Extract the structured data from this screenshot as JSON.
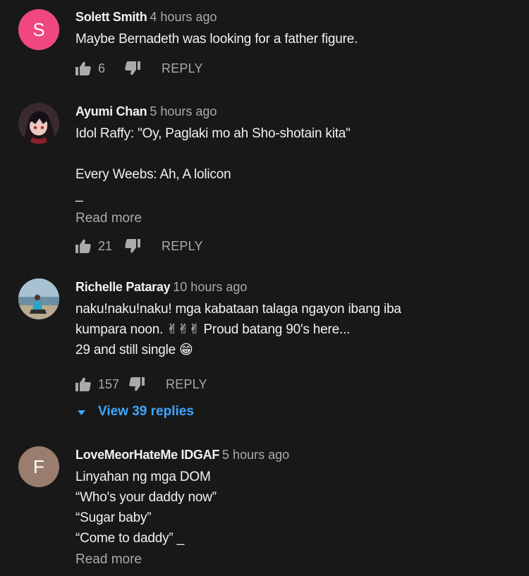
{
  "comments": [
    {
      "author": "Solett Smith",
      "time": "4 hours ago",
      "avatar": {
        "type": "letter",
        "letter": "S",
        "color": "#f0487e"
      },
      "lines": [
        "Maybe Bernadeth was looking for a father figure."
      ],
      "likes": "6",
      "reply_label": "REPLY"
    },
    {
      "author": "Ayumi Chan",
      "time": "5 hours ago",
      "avatar": {
        "type": "image",
        "description": "anime-character-icon"
      },
      "lines": [
        "Idol Raffy: \"Oy, Paglaki mo ah Sho-shotain kita\"",
        "",
        "Every Weebs: Ah, A lolicon",
        "_"
      ],
      "read_more": "Read more",
      "likes": "21",
      "reply_label": "REPLY"
    },
    {
      "author": "Richelle Pataray",
      "time": "10 hours ago",
      "avatar": {
        "type": "image",
        "description": "beach-photo-icon"
      },
      "lines": [
        "naku!naku!naku! mga kabataan talaga ngayon ibang iba",
        "kumpara noon. ✌✌✌ Proud batang 90's here...",
        "29 and still single 😁"
      ],
      "likes": "157",
      "reply_label": "REPLY",
      "replies_label": "View 39 replies"
    },
    {
      "author": "LoveMeorHateMe IDGAF",
      "time": "5 hours ago",
      "avatar": {
        "type": "letter",
        "letter": "F",
        "color": "#9a7d6e"
      },
      "lines": [
        "Linyahan ng mga DOM",
        "“Who's your daddy now”",
        "“Sugar baby”",
        "“Come to daddy” _"
      ],
      "read_more": "Read more"
    }
  ],
  "colors": {
    "background": "#181818",
    "text_primary": "#f1f1f1",
    "text_secondary": "#aaaaaa",
    "link_blue": "#3ea6ff"
  }
}
